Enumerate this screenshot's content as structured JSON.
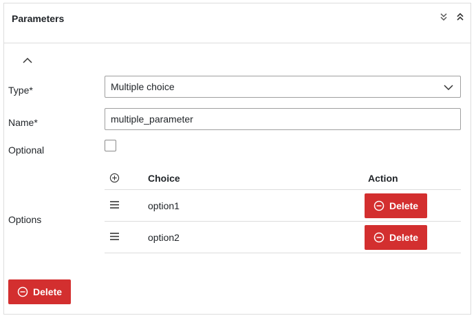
{
  "panel": {
    "title": "Parameters",
    "header_icons": [
      "expand-all-icon",
      "collapse-all-icon"
    ]
  },
  "form": {
    "type": {
      "label": "Type*",
      "value": "Multiple choice"
    },
    "name": {
      "label": "Name*",
      "value": "multiple_parameter"
    },
    "optional": {
      "label": "Optional",
      "checked": false
    },
    "options": {
      "label": "Options",
      "columns": {
        "choice": "Choice",
        "action": "Action"
      },
      "rows": [
        {
          "choice": "option1",
          "action_label": "Delete"
        },
        {
          "choice": "option2",
          "action_label": "Delete"
        }
      ]
    }
  },
  "footer": {
    "delete_label": "Delete"
  },
  "colors": {
    "danger": "#d32f2f",
    "border": "#dcdcdc"
  }
}
